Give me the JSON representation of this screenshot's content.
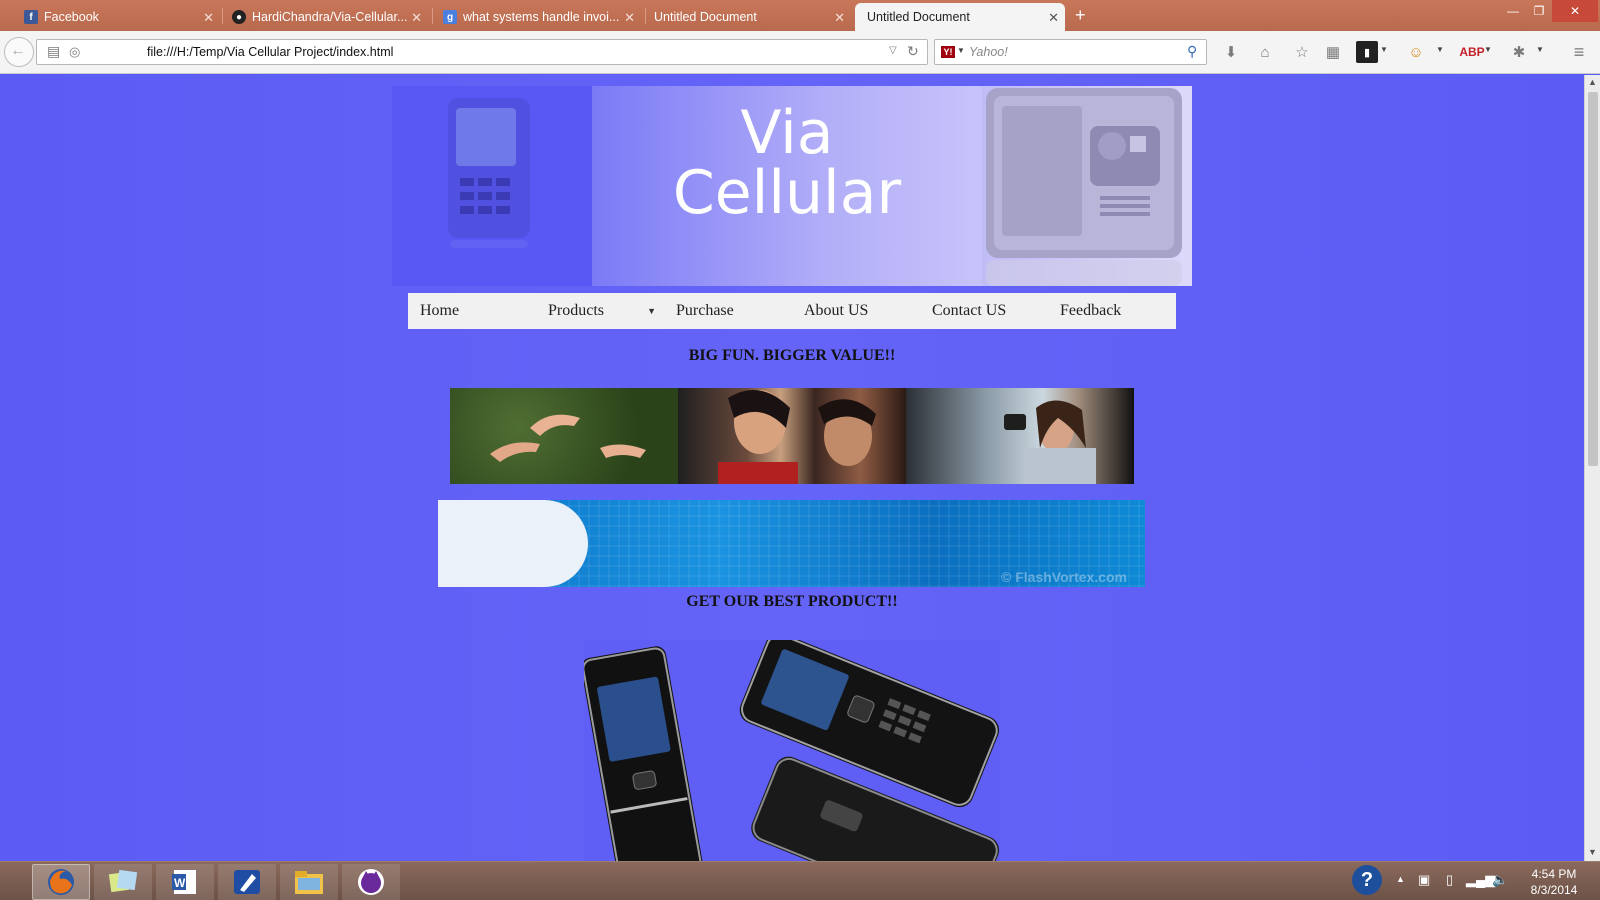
{
  "browser": {
    "tabs": [
      {
        "title": "Facebook",
        "favicon": "facebook-icon"
      },
      {
        "title": "HardiChandra/Via-Cellular...",
        "favicon": "github-icon"
      },
      {
        "title": "what systems handle invoi...",
        "favicon": "google-icon"
      },
      {
        "title": "Untitled Document",
        "favicon": ""
      },
      {
        "title": "Untitled Document",
        "favicon": "",
        "active": true
      }
    ],
    "url": "file:///H:/Temp/Via Cellular Project/index.html",
    "search_placeholder": "Yahoo!",
    "search_engine_icon": "yahoo-icon"
  },
  "site": {
    "title_line1": "Via",
    "title_line2": "Cellular",
    "menu": [
      "Home",
      "Products",
      "Purchase",
      "About US",
      "Contact US",
      "Feedback"
    ],
    "headline1": "BIG FUN. BIGGER VALUE!!",
    "flash_watermark": "© FlashVortex.com",
    "headline2": "GET OUR BEST PRODUCT!!"
  },
  "taskbar": {
    "time": "4:54 PM",
    "date": "8/3/2014",
    "apps": [
      "firefox-icon",
      "sticky-notes-icon",
      "word-icon",
      "pen-app-icon",
      "file-explorer-icon",
      "purple-cat-app-icon"
    ]
  },
  "colors": {
    "page_background": "#5f5ff6",
    "tab_strip": "#c0705a",
    "menu_background": "#f1f1f1"
  }
}
